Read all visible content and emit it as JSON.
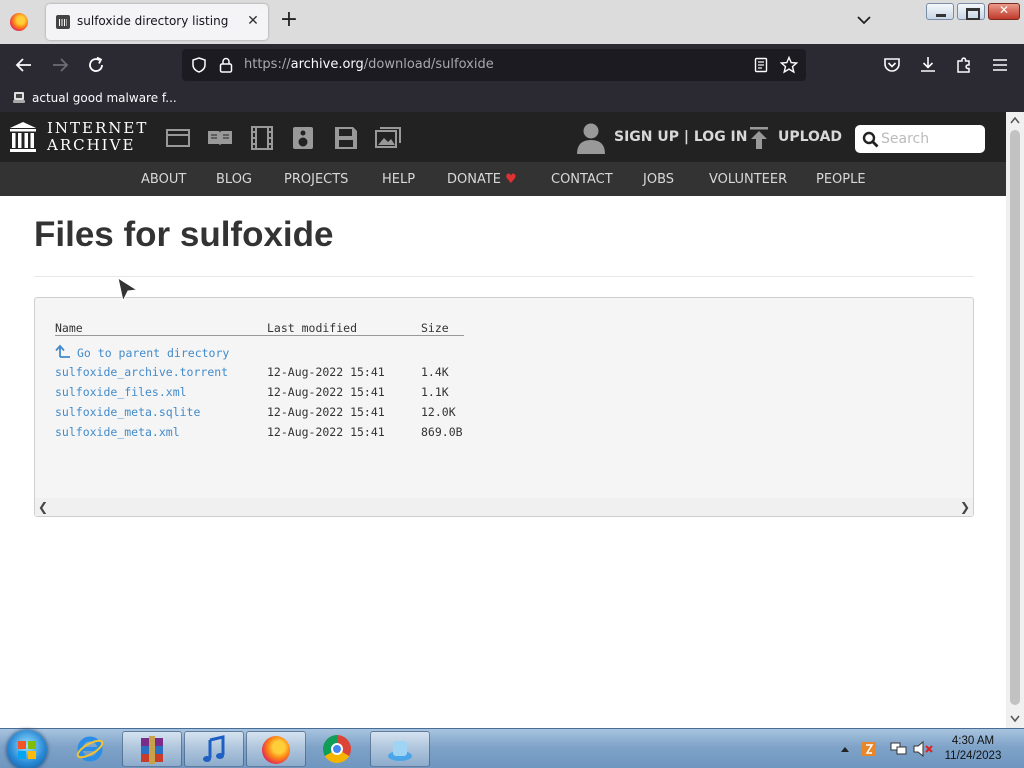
{
  "browser": {
    "tab_title": "sulfoxide directory listing",
    "url_prefix": "https://",
    "url_host": "archive.org",
    "url_path": "/download/sulfoxide",
    "bookmark_label": "actual good malware f..."
  },
  "ia_header": {
    "logo_line1": "INTERNET",
    "logo_line2": "ARCHIVE",
    "account_label": "SIGN UP | LOG IN",
    "upload_label": "UPLOAD",
    "search_placeholder": "Search",
    "nav": [
      "ABOUT",
      "BLOG",
      "PROJECTS",
      "HELP",
      "DONATE",
      "CONTACT",
      "JOBS",
      "VOLUNTEER",
      "PEOPLE"
    ]
  },
  "page": {
    "title": "Files for sulfoxide"
  },
  "listing": {
    "columns": {
      "name": "Name",
      "modified": "Last modified",
      "size": "Size"
    },
    "parent_link": "Go to parent directory",
    "files": [
      {
        "name": "sulfoxide_archive.torrent",
        "modified": "12-Aug-2022 15:41",
        "size": "1.4K"
      },
      {
        "name": "sulfoxide_files.xml",
        "modified": "12-Aug-2022 15:41",
        "size": "1.1K"
      },
      {
        "name": "sulfoxide_meta.sqlite",
        "modified": "12-Aug-2022 15:41",
        "size": "12.0K"
      },
      {
        "name": "sulfoxide_meta.xml",
        "modified": "12-Aug-2022 15:41",
        "size": "869.0B"
      }
    ]
  },
  "taskbar": {
    "time": "4:30 AM",
    "date": "11/24/2023"
  },
  "colors": {
    "link": "#428bca",
    "ia_header_bg": "#222222",
    "ia_nav_bg": "#333333",
    "donate_heart": "#e03131",
    "browser_toolbar": "#2b2a33"
  }
}
